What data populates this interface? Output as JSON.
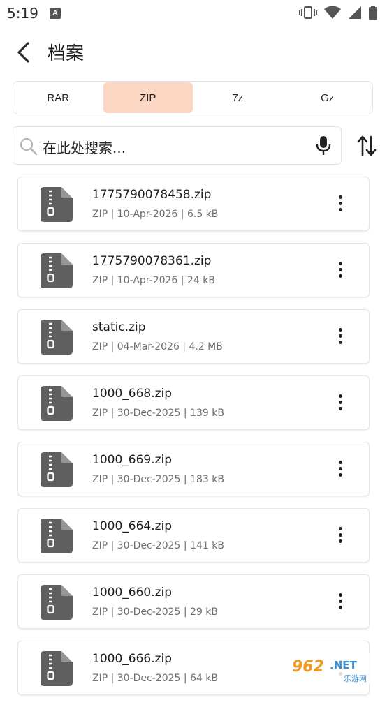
{
  "status_bar": {
    "time": "5:19",
    "notification_letter": "A"
  },
  "header": {
    "title": "档案"
  },
  "tabs": [
    {
      "label": "RAR",
      "active": false
    },
    {
      "label": "ZIP",
      "active": true
    },
    {
      "label": "7z",
      "active": false
    },
    {
      "label": "Gz",
      "active": false
    }
  ],
  "search": {
    "placeholder": "在此处搜索..."
  },
  "files": [
    {
      "name": "1775790078458.zip",
      "meta": "ZIP | 10-Apr-2026 | 6.5 kB"
    },
    {
      "name": "1775790078361.zip",
      "meta": "ZIP | 10-Apr-2026 | 24 kB"
    },
    {
      "name": "static.zip",
      "meta": "ZIP | 04-Mar-2026 | 4.2 MB"
    },
    {
      "name": "1000_668.zip",
      "meta": "ZIP | 30-Dec-2025 | 139 kB"
    },
    {
      "name": "1000_669.zip",
      "meta": "ZIP | 30-Dec-2025 | 183 kB"
    },
    {
      "name": "1000_664.zip",
      "meta": "ZIP | 30-Dec-2025 | 141 kB"
    },
    {
      "name": "1000_660.zip",
      "meta": "ZIP | 30-Dec-2025 | 29 kB"
    },
    {
      "name": "1000_666.zip",
      "meta": "ZIP | 30-Dec-2025 | 64 kB"
    }
  ],
  "watermark": {
    "brand": "962.NET",
    "subtitle": "乐游网"
  },
  "colors": {
    "active_tab": "#fcd8c4",
    "file_icon": "#5f5f5f"
  }
}
